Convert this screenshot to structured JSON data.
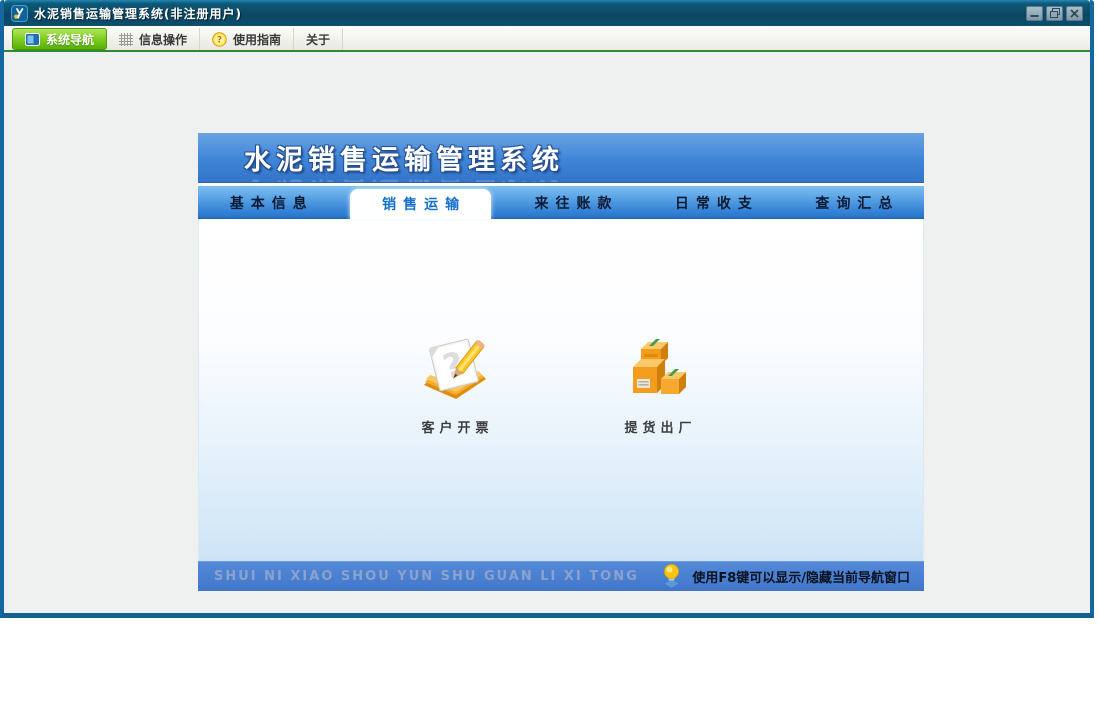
{
  "titlebar": {
    "title": "水泥销售运输管理系统(非注册用户)",
    "app_icon": "app-logo-icon",
    "controls": {
      "minimize_icon": "minimize-icon",
      "restore_icon": "restore-icon",
      "close_icon": "close-icon"
    }
  },
  "toolbar": {
    "items": [
      {
        "label": "系统导航",
        "icon": "navigation-panel-icon",
        "active": true
      },
      {
        "label": "信息操作",
        "icon": "grid-icon",
        "active": false
      },
      {
        "label": "使用指南",
        "icon": "help-coin-icon",
        "active": false
      },
      {
        "label": "关于",
        "icon": null,
        "active": false
      }
    ]
  },
  "panel": {
    "title": "水泥销售运输管理系统",
    "tabs": [
      {
        "label": "基本信息",
        "active": false
      },
      {
        "label": "销售运输",
        "active": true
      },
      {
        "label": "来往账款",
        "active": false
      },
      {
        "label": "日常收支",
        "active": false
      },
      {
        "label": "查询汇总",
        "active": false
      }
    ],
    "shortcuts": [
      {
        "label": "客户开票",
        "icon": "invoice-notepad-pencil-icon"
      },
      {
        "label": "提货出厂",
        "icon": "pickup-boxes-icon"
      }
    ],
    "footer": {
      "watermark": "SHUI NI XIAO SHOU YUN SHU GUAN LI XI TONG",
      "hint": "使用F8键可以显示/隐藏当前导航窗口",
      "hint_icon": "lightbulb-icon"
    }
  },
  "colors": {
    "titlebar": "#0c4964",
    "toolbar_active_green": "#6cc11a",
    "panel_blue": "#3e85d8",
    "footer_blue": "#4a7ed0",
    "icon_orange": "#f09c1c"
  }
}
